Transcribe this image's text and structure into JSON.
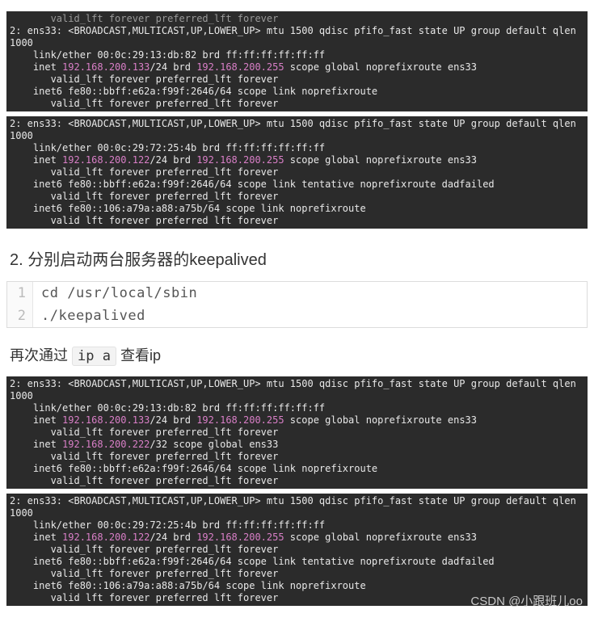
{
  "term1": {
    "l0": "2: ens33: <BROADCAST,MULTICAST,UP,LOWER_UP> mtu 1500 qdisc pfifo_fast state UP group default qlen 1000",
    "l1": "    link/ether 00:0c:29:13:db:82 brd ff:ff:ff:ff:ff:ff",
    "l2a": "    inet ",
    "l2ip": "192.168.200.133",
    "l2b": "/24 brd ",
    "l2brd": "192.168.200.255",
    "l2c": " scope global noprefixroute ens33",
    "l3": "       valid_lft forever preferred_lft forever",
    "l4": "    inet6 fe80::bbff:e62a:f99f:2646/64 scope link noprefixroute",
    "l5": "       valid_lft forever preferred_lft forever"
  },
  "term2": {
    "l0": "2: ens33: <BROADCAST,MULTICAST,UP,LOWER_UP> mtu 1500 qdisc pfifo_fast state UP group default qlen 1000",
    "l1": "    link/ether 00:0c:29:72:25:4b brd ff:ff:ff:ff:ff:ff",
    "l2a": "    inet ",
    "l2ip": "192.168.200.122",
    "l2b": "/24 brd ",
    "l2brd": "192.168.200.255",
    "l2c": " scope global noprefixroute ens33",
    "l3": "       valid_lft forever preferred_lft forever",
    "l4": "    inet6 fe80::bbff:e62a:f99f:2646/64 scope link tentative noprefixroute dadfailed",
    "l5": "       valid_lft forever preferred_lft forever",
    "l6": "    inet6 fe80::106:a79a:a88:a75b/64 scope link noprefixroute",
    "l7": "       valid lft forever preferred lft forever"
  },
  "step2_heading": "2. 分别启动两台服务器的keepalived",
  "codeblock": {
    "line1_num": "1",
    "line1_code": "cd /usr/local/sbin",
    "line2_num": "2",
    "line2_code": "./keepalived"
  },
  "para_prefix": "再次通过 ",
  "para_code": "ip a",
  "para_suffix": " 查看ip",
  "term3": {
    "l0": "2: ens33: <BROADCAST,MULTICAST,UP,LOWER_UP> mtu 1500 qdisc pfifo_fast state UP group default qlen 1000",
    "l1": "    link/ether 00:0c:29:13:db:82 brd ff:ff:ff:ff:ff:ff",
    "l2a": "    inet ",
    "l2ip": "192.168.200.133",
    "l2b": "/24 brd ",
    "l2brd": "192.168.200.255",
    "l2c": " scope global noprefixroute ens33",
    "l3": "       valid_lft forever preferred_lft forever",
    "l4a": "    inet ",
    "l4ip": "192.168.200.222",
    "l4b": "/32 scope global ens33",
    "l5": "       valid_lft forever preferred_lft forever",
    "l6": "    inet6 fe80::bbff:e62a:f99f:2646/64 scope link noprefixroute",
    "l7": "       valid_lft forever preferred_lft forever"
  },
  "term4": {
    "l0": "2: ens33: <BROADCAST,MULTICAST,UP,LOWER_UP> mtu 1500 qdisc pfifo_fast state UP group default qlen 1000",
    "l1": "    link/ether 00:0c:29:72:25:4b brd ff:ff:ff:ff:ff:ff",
    "l2a": "    inet ",
    "l2ip": "192.168.200.122",
    "l2b": "/24 brd ",
    "l2brd": "192.168.200.255",
    "l2c": " scope global noprefixroute ens33",
    "l3": "       valid_lft forever preferred_lft forever",
    "l4": "    inet6 fe80::bbff:e62a:f99f:2646/64 scope link tentative noprefixroute dadfailed",
    "l5": "       valid_lft forever preferred_lft forever",
    "l6": "    inet6 fe80::106:a79a:a88:a75b/64 scope link noprefixroute",
    "l7": "       valid lft forever preferred lft forever"
  },
  "watermark": "CSDN @小跟班儿oo"
}
